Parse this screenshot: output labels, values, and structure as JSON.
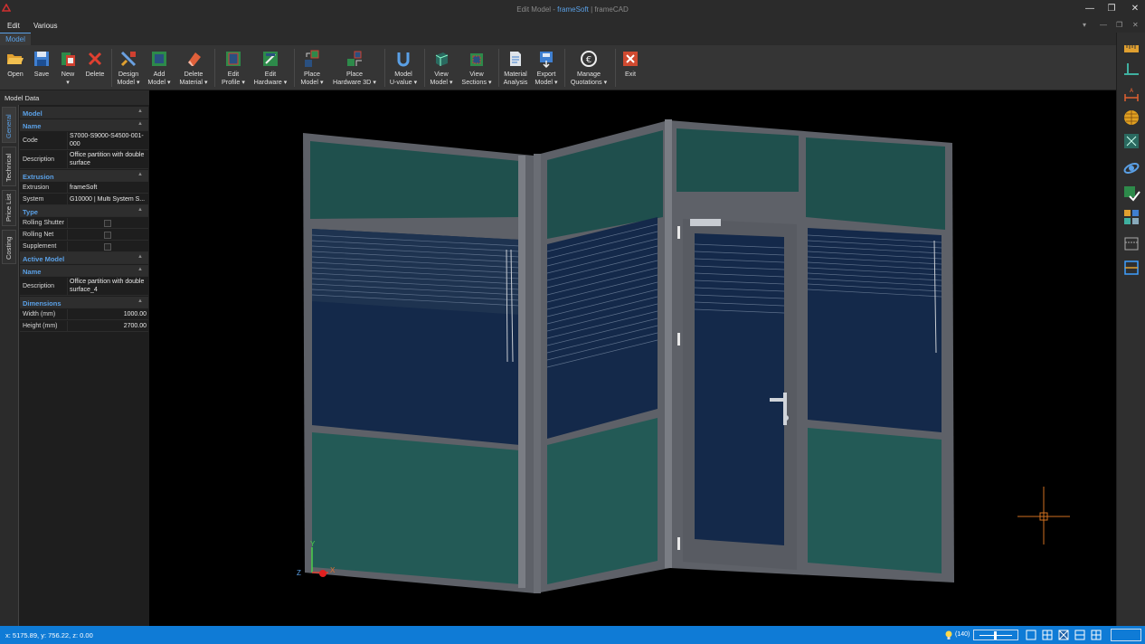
{
  "window": {
    "title_prefix": "Edit Model - ",
    "title_app": "frameSoft",
    "title_suffix": " | frameCAD"
  },
  "menu": {
    "edit": "Edit",
    "various": "Various"
  },
  "ribbon_tab": "Model",
  "ribbon": [
    {
      "id": "open",
      "label": "Open",
      "icon": "folder-icon"
    },
    {
      "id": "save",
      "label": "Save",
      "icon": "floppy-icon"
    },
    {
      "id": "new",
      "label": "New",
      "label2": "▾",
      "icon": "new-doc-icon"
    },
    {
      "id": "delete",
      "label": "Delete",
      "icon": "x-icon"
    },
    {
      "id": "design",
      "label": "Design",
      "label2": "Model ▾",
      "icon": "design-icon"
    },
    {
      "id": "add",
      "label": "Add",
      "label2": "Model ▾",
      "icon": "add-model-icon"
    },
    {
      "id": "delmat",
      "label": "Delete",
      "label2": "Material ▾",
      "icon": "eraser-icon"
    },
    {
      "id": "editprofile",
      "label": "Edit",
      "label2": "Profile ▾",
      "icon": "profile-icon"
    },
    {
      "id": "edithw",
      "label": "Edit",
      "label2": "Hardware ▾",
      "icon": "hardware-icon"
    },
    {
      "id": "place",
      "label": "Place",
      "label2": "Model ▾",
      "icon": "place-model-icon"
    },
    {
      "id": "placehw",
      "label": "Place",
      "label2": "Hardware 3D ▾",
      "icon": "place-hardware-icon"
    },
    {
      "id": "uvalue",
      "label": "Model",
      "label2": "U-value ▾",
      "icon": "u-value-icon"
    },
    {
      "id": "view",
      "label": "View",
      "label2": "Model ▾",
      "icon": "cube-icon"
    },
    {
      "id": "sections",
      "label": "View",
      "label2": "Sections ▾",
      "icon": "sections-icon"
    },
    {
      "id": "analysis",
      "label": "Material",
      "label2": "Analysis",
      "icon": "analysis-icon"
    },
    {
      "id": "export",
      "label": "Export",
      "label2": "Model ▾",
      "icon": "export-icon"
    },
    {
      "id": "quotations",
      "label": "Manage",
      "label2": "Quotations ▾",
      "icon": "euro-icon"
    },
    {
      "id": "exit",
      "label": "Exit",
      "icon": "exit-icon"
    }
  ],
  "panel": {
    "title": "Model Data",
    "tabs": [
      "General",
      "Technical",
      "Price List",
      "Costing"
    ],
    "sections": {
      "model": "Model",
      "name": "Name",
      "extrusion": "Extrusion",
      "type": "Type",
      "active_model": "Active Model",
      "name2": "Name",
      "dimensions": "Dimensions"
    },
    "fields": {
      "code_k": "Code",
      "code_v": "S7000-S9000-S4500-001-000",
      "desc_k": "Description",
      "desc_v": "Office partition with double surface",
      "extr_k": "Extrusion",
      "extr_v": "frameSoft",
      "sys_k": "System",
      "sys_v": "G10000 | Multi System S...",
      "rs_k": "Rolling Shutter",
      "rn_k": "Rolling Net",
      "sup_k": "Supplement",
      "adesc_k": "Description",
      "adesc_v": "Office partition with double surface_4",
      "w_k": "Width (mm)",
      "w_v": "1000.00",
      "h_k": "Height (mm)",
      "h_v": "2700.00"
    }
  },
  "status": {
    "coords": "x: 5175.89, y: 756.22, z: 0.00",
    "zoom": "(140)"
  },
  "axes": {
    "x": "X",
    "y": "Y",
    "z": "Z"
  },
  "colors": {
    "accent": "#5aa0e6",
    "status": "#0f7bd6",
    "frame": "#6b6e75",
    "panel": "#1f4f4d",
    "glass": "#13284a"
  }
}
